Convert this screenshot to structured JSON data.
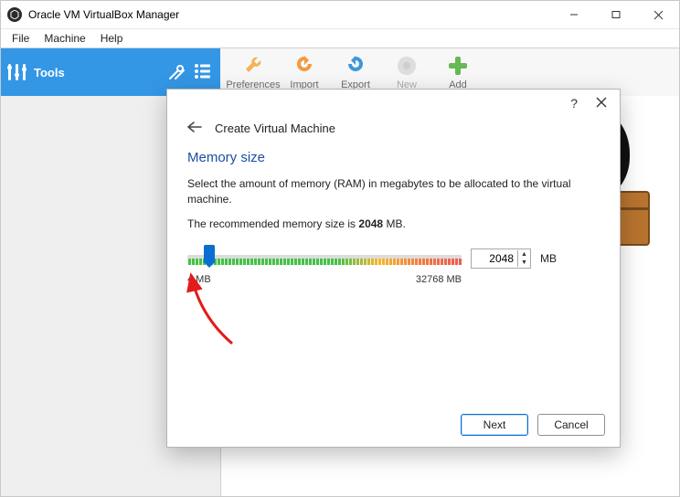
{
  "window": {
    "title": "Oracle VM VirtualBox Manager"
  },
  "menubar": {
    "file": "File",
    "machine": "Machine",
    "help": "Help"
  },
  "toolbar": {
    "tools_label": "Tools",
    "preferences": "Preferences",
    "import": "Import",
    "export": "Export",
    "new": "New",
    "add": "Add"
  },
  "dialog": {
    "help_symbol": "?",
    "title": "Create Virtual Machine",
    "section_title": "Memory size",
    "description": "Select the amount of memory (RAM) in megabytes to be allocated to the virtual machine.",
    "recommended_prefix": "The recommended memory size is ",
    "recommended_value": "2048",
    "recommended_suffix": " MB.",
    "slider": {
      "min_label": "4 MB",
      "max_label": "32768 MB",
      "value": "2048",
      "unit": "MB"
    },
    "buttons": {
      "next": "Next",
      "cancel": "Cancel"
    }
  }
}
